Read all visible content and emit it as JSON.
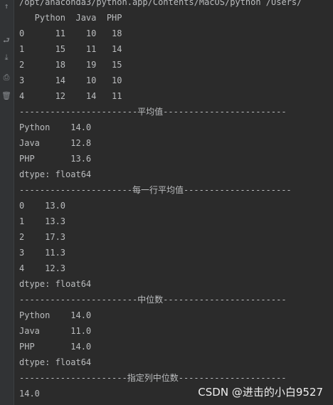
{
  "gutter": {
    "icons": [
      {
        "name": "scroll-up-icon",
        "glyph": "↑"
      },
      {
        "name": "wrap-lines-icon",
        "glyph": "⮐"
      },
      {
        "name": "scroll-to-end-icon",
        "glyph": "⤓"
      },
      {
        "name": "print-icon",
        "glyph": "⎙"
      },
      {
        "name": "trash-icon",
        "glyph": "🗑"
      }
    ]
  },
  "console": {
    "lines": [
      "/opt/anaconda3/python.app/Contents/MacOS/python /Users/",
      "   Python  Java  PHP",
      "0      11    10   18",
      "1      15    11   14",
      "2      18    19   15",
      "3      14    10   10",
      "4      12    14   11",
      "-----------------------平均值------------------------",
      "Python    14.0",
      "Java      12.8",
      "PHP       13.6",
      "dtype: float64",
      "----------------------每一行平均值---------------------",
      "0    13.0",
      "1    13.3",
      "2    17.3",
      "3    11.3",
      "4    12.3",
      "dtype: float64",
      "-----------------------中位数------------------------",
      "Python    14.0",
      "Java      11.0",
      "PHP       14.0",
      "dtype: float64",
      "---------------------指定列中位数---------------------",
      "14.0"
    ]
  },
  "watermark": "CSDN @进击的小白9527"
}
